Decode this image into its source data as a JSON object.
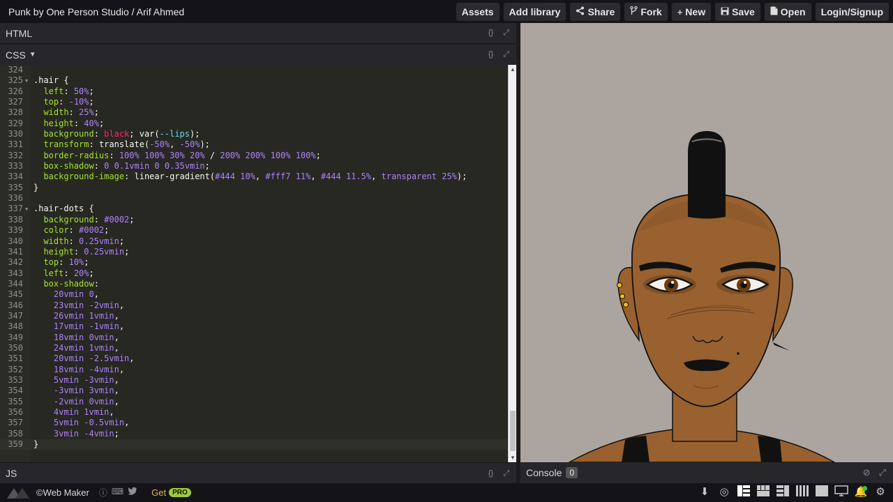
{
  "app": {
    "title": "Punk by One Person Studio / Arif Ahmed"
  },
  "toolbar": {
    "assets": "Assets",
    "add_library": "Add library",
    "share": "Share",
    "fork": "Fork",
    "new": "New",
    "save": "Save",
    "open": "Open",
    "login": "Login/Signup"
  },
  "panes": {
    "html": "HTML",
    "css": "CSS",
    "js": "JS",
    "console": "Console",
    "console_count": "0"
  },
  "editor": {
    "lines": [
      {
        "n": "324",
        "fold": false,
        "tokens": []
      },
      {
        "n": "325",
        "fold": true,
        "tokens": [
          [
            "sel",
            ".hair "
          ],
          [
            "pun",
            "{"
          ]
        ]
      },
      {
        "n": "326",
        "fold": false,
        "tokens": [
          [
            "pun",
            "  "
          ],
          [
            "prop",
            "left"
          ],
          [
            "pun",
            ": "
          ],
          [
            "num",
            "50%"
          ],
          [
            "pun",
            ";"
          ]
        ]
      },
      {
        "n": "327",
        "fold": false,
        "tokens": [
          [
            "pun",
            "  "
          ],
          [
            "prop",
            "top"
          ],
          [
            "pun",
            ": "
          ],
          [
            "num",
            "-10%"
          ],
          [
            "pun",
            ";"
          ]
        ]
      },
      {
        "n": "328",
        "fold": false,
        "tokens": [
          [
            "pun",
            "  "
          ],
          [
            "prop",
            "width"
          ],
          [
            "pun",
            ": "
          ],
          [
            "num",
            "25%"
          ],
          [
            "pun",
            ";"
          ]
        ]
      },
      {
        "n": "329",
        "fold": false,
        "tokens": [
          [
            "pun",
            "  "
          ],
          [
            "prop",
            "height"
          ],
          [
            "pun",
            ": "
          ],
          [
            "num",
            "40%"
          ],
          [
            "pun",
            ";"
          ]
        ]
      },
      {
        "n": "330",
        "fold": false,
        "tokens": [
          [
            "pun",
            "  "
          ],
          [
            "prop",
            "background"
          ],
          [
            "pun",
            ": "
          ],
          [
            "kw",
            "black"
          ],
          [
            "pun",
            "; "
          ],
          [
            "pun",
            "var("
          ],
          [
            "var",
            "--lips"
          ],
          [
            "pun",
            ");"
          ]
        ]
      },
      {
        "n": "331",
        "fold": false,
        "tokens": [
          [
            "pun",
            "  "
          ],
          [
            "prop",
            "transform"
          ],
          [
            "pun",
            ": "
          ],
          [
            "pun",
            "translate("
          ],
          [
            "num",
            "-50%"
          ],
          [
            "pun",
            ", "
          ],
          [
            "num",
            "-50%"
          ],
          [
            "pun",
            ");"
          ]
        ]
      },
      {
        "n": "332",
        "fold": false,
        "tokens": [
          [
            "pun",
            "  "
          ],
          [
            "prop",
            "border-radius"
          ],
          [
            "pun",
            ": "
          ],
          [
            "num",
            "100% 100% 30% 20%"
          ],
          [
            "pun",
            " / "
          ],
          [
            "num",
            "200% 200% 100% 100%"
          ],
          [
            "pun",
            ";"
          ]
        ]
      },
      {
        "n": "333",
        "fold": false,
        "tokens": [
          [
            "pun",
            "  "
          ],
          [
            "prop",
            "box-shadow"
          ],
          [
            "pun",
            ": "
          ],
          [
            "num",
            "0 0.1vmin 0 0.35vmin"
          ],
          [
            "pun",
            ";"
          ]
        ]
      },
      {
        "n": "334",
        "fold": false,
        "tokens": [
          [
            "pun",
            "  "
          ],
          [
            "prop",
            "background-image"
          ],
          [
            "pun",
            ": "
          ],
          [
            "pun",
            "linear-gradient("
          ],
          [
            "num",
            "#444 10%"
          ],
          [
            "pun",
            ", "
          ],
          [
            "num",
            "#fff7 11%"
          ],
          [
            "pun",
            ", "
          ],
          [
            "num",
            "#444 11.5%"
          ],
          [
            "pun",
            ", "
          ],
          [
            "num",
            "transparent 25%"
          ],
          [
            "pun",
            ");"
          ]
        ]
      },
      {
        "n": "335",
        "fold": false,
        "tokens": [
          [
            "pun",
            "}"
          ]
        ]
      },
      {
        "n": "336",
        "fold": false,
        "tokens": []
      },
      {
        "n": "337",
        "fold": true,
        "tokens": [
          [
            "sel",
            ".hair-dots "
          ],
          [
            "pun",
            "{"
          ]
        ]
      },
      {
        "n": "338",
        "fold": false,
        "tokens": [
          [
            "pun",
            "  "
          ],
          [
            "prop",
            "background"
          ],
          [
            "pun",
            ": "
          ],
          [
            "num",
            "#0002"
          ],
          [
            "pun",
            ";"
          ]
        ]
      },
      {
        "n": "339",
        "fold": false,
        "tokens": [
          [
            "pun",
            "  "
          ],
          [
            "prop",
            "color"
          ],
          [
            "pun",
            ": "
          ],
          [
            "num",
            "#0002"
          ],
          [
            "pun",
            ";"
          ]
        ]
      },
      {
        "n": "340",
        "fold": false,
        "tokens": [
          [
            "pun",
            "  "
          ],
          [
            "prop",
            "width"
          ],
          [
            "pun",
            ": "
          ],
          [
            "num",
            "0.25vmin"
          ],
          [
            "pun",
            ";"
          ]
        ]
      },
      {
        "n": "341",
        "fold": false,
        "tokens": [
          [
            "pun",
            "  "
          ],
          [
            "prop",
            "height"
          ],
          [
            "pun",
            ": "
          ],
          [
            "num",
            "0.25vmin"
          ],
          [
            "pun",
            ";"
          ]
        ]
      },
      {
        "n": "342",
        "fold": false,
        "tokens": [
          [
            "pun",
            "  "
          ],
          [
            "prop",
            "top"
          ],
          [
            "pun",
            ": "
          ],
          [
            "num",
            "10%"
          ],
          [
            "pun",
            ";"
          ]
        ]
      },
      {
        "n": "343",
        "fold": false,
        "tokens": [
          [
            "pun",
            "  "
          ],
          [
            "prop",
            "left"
          ],
          [
            "pun",
            ": "
          ],
          [
            "num",
            "20%"
          ],
          [
            "pun",
            ";"
          ]
        ]
      },
      {
        "n": "344",
        "fold": false,
        "tokens": [
          [
            "pun",
            "  "
          ],
          [
            "prop",
            "box-shadow"
          ],
          [
            "pun",
            ":"
          ]
        ]
      },
      {
        "n": "345",
        "fold": false,
        "tokens": [
          [
            "pun",
            "    "
          ],
          [
            "num",
            "20vmin 0"
          ],
          [
            "pun",
            ","
          ]
        ]
      },
      {
        "n": "346",
        "fold": false,
        "tokens": [
          [
            "pun",
            "    "
          ],
          [
            "num",
            "23vmin -2vmin"
          ],
          [
            "pun",
            ","
          ]
        ]
      },
      {
        "n": "347",
        "fold": false,
        "tokens": [
          [
            "pun",
            "    "
          ],
          [
            "num",
            "26vmin 1vmin"
          ],
          [
            "pun",
            ","
          ]
        ]
      },
      {
        "n": "348",
        "fold": false,
        "tokens": [
          [
            "pun",
            "    "
          ],
          [
            "num",
            "17vmin -1vmin"
          ],
          [
            "pun",
            ","
          ]
        ]
      },
      {
        "n": "349",
        "fold": false,
        "tokens": [
          [
            "pun",
            "    "
          ],
          [
            "num",
            "18vmin 0vmin"
          ],
          [
            "pun",
            ","
          ]
        ]
      },
      {
        "n": "350",
        "fold": false,
        "tokens": [
          [
            "pun",
            "    "
          ],
          [
            "num",
            "24vmin 1vmin"
          ],
          [
            "pun",
            ","
          ]
        ]
      },
      {
        "n": "351",
        "fold": false,
        "tokens": [
          [
            "pun",
            "    "
          ],
          [
            "num",
            "20vmin -2.5vmin"
          ],
          [
            "pun",
            ","
          ]
        ]
      },
      {
        "n": "352",
        "fold": false,
        "tokens": [
          [
            "pun",
            "    "
          ],
          [
            "num",
            "18vmin -4vmin"
          ],
          [
            "pun",
            ","
          ]
        ]
      },
      {
        "n": "353",
        "fold": false,
        "tokens": [
          [
            "pun",
            "    "
          ],
          [
            "num",
            "5vmin -3vmin"
          ],
          [
            "pun",
            ","
          ]
        ]
      },
      {
        "n": "354",
        "fold": false,
        "tokens": [
          [
            "pun",
            "    "
          ],
          [
            "num",
            "-3vmin 3vmin"
          ],
          [
            "pun",
            ","
          ]
        ]
      },
      {
        "n": "355",
        "fold": false,
        "tokens": [
          [
            "pun",
            "    "
          ],
          [
            "num",
            "-2vmin 0vmin"
          ],
          [
            "pun",
            ","
          ]
        ]
      },
      {
        "n": "356",
        "fold": false,
        "tokens": [
          [
            "pun",
            "    "
          ],
          [
            "num",
            "4vmin 1vmin"
          ],
          [
            "pun",
            ","
          ]
        ]
      },
      {
        "n": "357",
        "fold": false,
        "tokens": [
          [
            "pun",
            "    "
          ],
          [
            "num",
            "5vmin -0.5vmin"
          ],
          [
            "pun",
            ","
          ]
        ]
      },
      {
        "n": "358",
        "fold": false,
        "tokens": [
          [
            "pun",
            "    "
          ],
          [
            "num",
            "3vmin -4vmin"
          ],
          [
            "pun",
            ";"
          ]
        ]
      },
      {
        "n": "359",
        "fold": false,
        "tokens": [
          [
            "pun",
            "}"
          ]
        ]
      }
    ],
    "active_line": "359"
  },
  "footer": {
    "brand": "©Web Maker",
    "get": "Get",
    "pro": "PRO"
  },
  "colors": {
    "preview_bg": "#aca59f",
    "skin": "#99612f",
    "editor_bg": "#272822",
    "pro_badge": "#9ccc3a",
    "get_text": "#e0b84a"
  },
  "icons": [
    "share-icon",
    "fork-icon",
    "plus-icon",
    "save-icon",
    "open-file-icon",
    "braces-icon",
    "expand-icon",
    "clear-icon",
    "help-icon",
    "keyboard-icon",
    "twitter-icon",
    "download-icon",
    "code-settings-icon",
    "layout-icon",
    "monitor-icon",
    "notification-icon",
    "gear-icon"
  ]
}
